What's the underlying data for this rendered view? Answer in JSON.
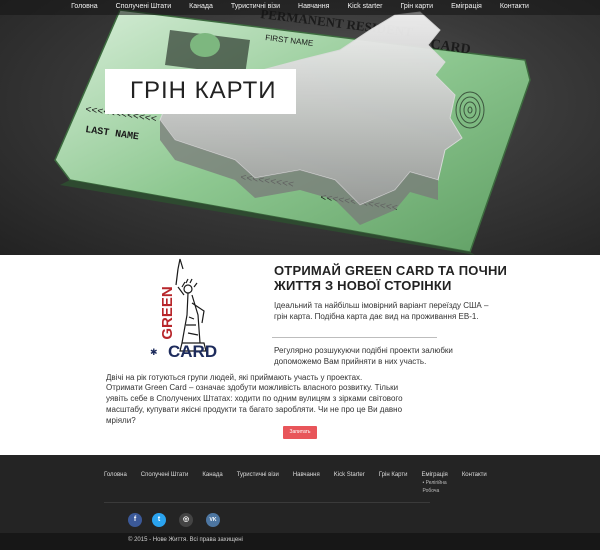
{
  "nav": {
    "items": [
      "Головна",
      "Сполучені Штати",
      "Канада",
      "Туристичні візи",
      "Навчання",
      "Kick starter",
      "Грін карти",
      "Еміграція",
      "Контакти"
    ]
  },
  "hero": {
    "title": "ГРІН КАРТИ",
    "card_text_1": "PERMANENT RESIDENT",
    "card_text_2": "CARD",
    "card_text_3": "LAST NAME",
    "card_text_4": "FIRST NAME"
  },
  "content": {
    "logo_text_top": "GREEN",
    "logo_text_bottom": "CARD",
    "headline": "ОТРИМАЙ GREEN CARD  ТА ПОЧНИ ЖИТТЯ З НОВОЇ СТОРІНКИ",
    "para1": "Ідеальний та найбільш імовірний варіант переїзду США – грін карта. Подібна карта дає вид на проживання ЕВ-1.",
    "para2": "Регулярно розшукуючи подібні проекти залюбки допоможемо Вам прийняти в них участь.",
    "para3": "Двічі на рік готуються групи людей, які приймають участь у проектах.",
    "para4": "Отримати Green Card – означає здобути можливість власного розвитку. Тільки уявіть себе в Сполучених Штатах: ходити по одним вулицям з зірками світового масштабу, купувати якісні продукти та багато заробляти. Чи не про це Ви давно мріяли?",
    "cta_label": "Запитать"
  },
  "footer": {
    "nav": [
      "Головна",
      "Сполучені Штати",
      "Канада",
      "Туристичні візи",
      "Навчання",
      "Kick Starter",
      "Грін Карти",
      "Еміграція",
      "Контакти"
    ],
    "submenu": [
      "• Релігійна",
      "Робоча"
    ],
    "social": {
      "fb": "f",
      "tw": "t",
      "ig": "◎",
      "vk": "VK"
    },
    "copyright": "© 2015 - Нове Життя. Всі права захищені"
  },
  "colors": {
    "accent": "#e8555a",
    "footer_bg": "#242424",
    "logo_red": "#b8262b",
    "logo_navy": "#1d2b5c"
  }
}
